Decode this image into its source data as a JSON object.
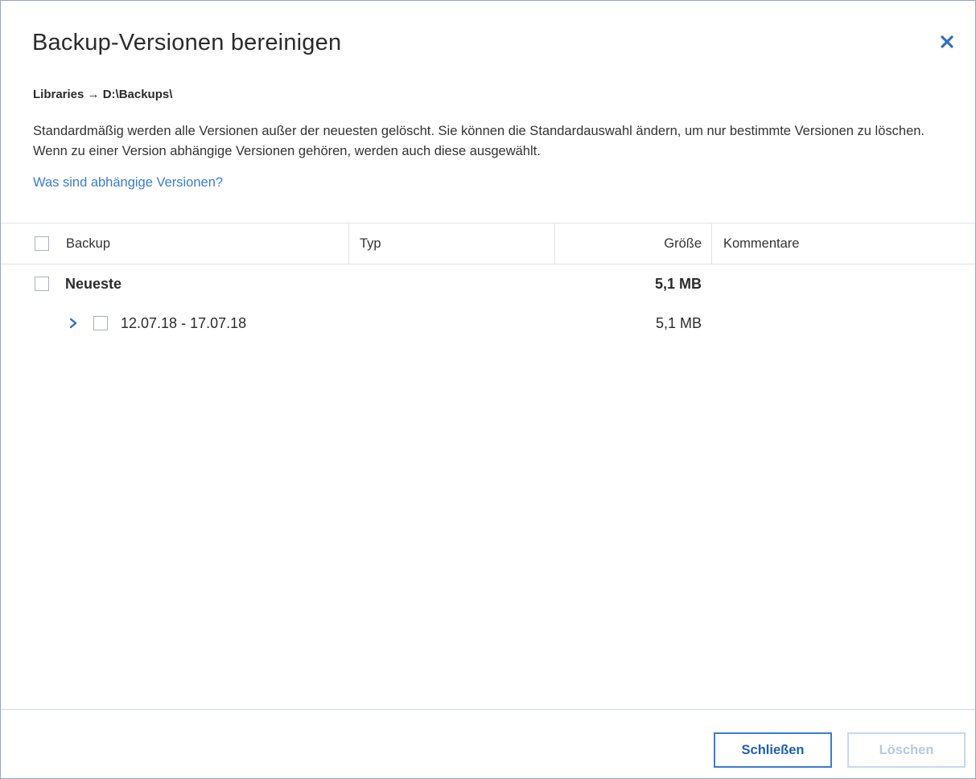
{
  "dialog": {
    "title": "Backup-Versionen bereinigen",
    "breadcrumb": "Libraries → D:\\Backups\\",
    "description": "Standardmäßig werden alle Versionen außer der neuesten gelöscht. Sie können die Standardauswahl ändern, um nur bestimmte Versionen zu löschen. Wenn zu einer Version abhängige Versionen gehören, werden auch diese ausgewählt.",
    "help_link": "Was sind abhängige Versionen?",
    "close_icon": "close-icon"
  },
  "table": {
    "columns": {
      "backup": "Backup",
      "type": "Typ",
      "size": "Größe",
      "comments": "Kommentare"
    },
    "rows": [
      {
        "label": "Neueste",
        "size": "5,1 MB",
        "bold": true,
        "checked": false
      },
      {
        "label": "12.07.18 - 17.07.18",
        "size": "5,1 MB",
        "bold": false,
        "checked": false,
        "expandable": true
      }
    ]
  },
  "footer": {
    "close_label": "Schließen",
    "delete_label": "Löschen",
    "delete_enabled": false
  },
  "colors": {
    "accent": "#3a7bd5",
    "link": "#3a7bd5",
    "disabled": "#b8c9e0",
    "border": "#dde3ea"
  }
}
